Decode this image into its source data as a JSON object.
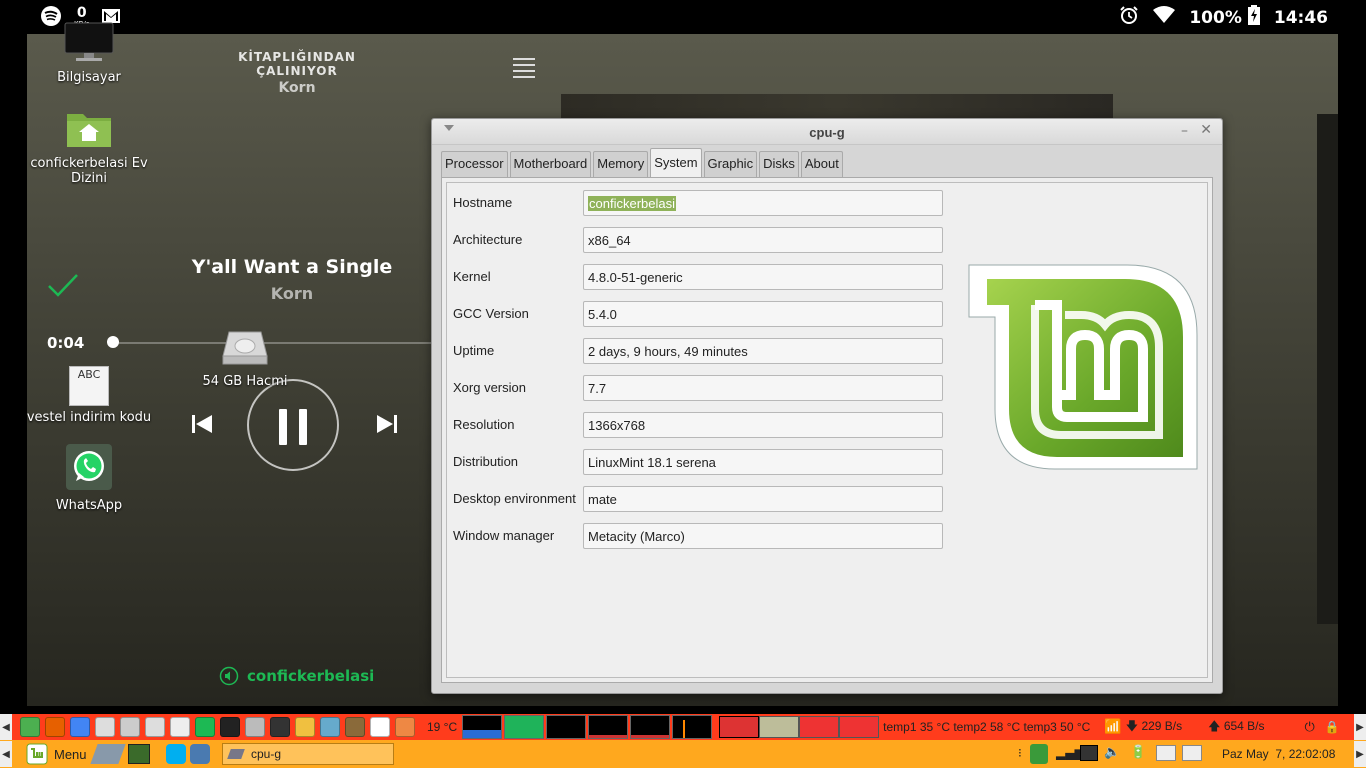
{
  "status_bar": {
    "net_speed_value": "0",
    "net_speed_unit": "KB/s",
    "battery": "100%",
    "time": "14:46",
    "icons": [
      "spotify-icon",
      "gmail-icon",
      "alarm-icon",
      "wifi-icon",
      "battery-icon"
    ]
  },
  "spotify": {
    "playing_from_label": "KİTAPLIĞINDAN ÇALINIYOR",
    "playing_from_name": "Korn",
    "track_title": "Y'all Want a Single",
    "track_artist": "Korn",
    "elapsed": "0:04",
    "progress": 0.02,
    "device": "confickerbelasi",
    "accent": "#1db954"
  },
  "desktop_icons": [
    {
      "label": "Bilgisayar"
    },
    {
      "label": "confickerbelasi Ev Dizini"
    },
    {
      "label": "54 GB Hacmi"
    },
    {
      "label": "vestel indirim kodu",
      "thumb": "ABC"
    },
    {
      "label": "WhatsApp"
    }
  ],
  "window": {
    "title": "cpu-g",
    "tabs": [
      "Processor",
      "Motherboard",
      "Memory",
      "System",
      "Graphic",
      "Disks",
      "About"
    ],
    "active_tab": "System",
    "fields": [
      {
        "label": "Hostname",
        "value": "confickerbelasi"
      },
      {
        "label": "Architecture",
        "value": "x86_64"
      },
      {
        "label": "Kernel",
        "value": "4.8.0-51-generic"
      },
      {
        "label": "GCC Version",
        "value": "5.4.0"
      },
      {
        "label": "Uptime",
        "value": "2 days, 9 hours, 49 minutes"
      },
      {
        "label": "Xorg version",
        "value": "7.7"
      },
      {
        "label": "Resolution",
        "value": "1366x768"
      },
      {
        "label": "Distribution",
        "value": "LinuxMint 18.1 serena"
      },
      {
        "label": "Desktop environment",
        "value": "mate"
      },
      {
        "label": "Window manager",
        "value": "Metacity (Marco)"
      }
    ],
    "logo_colors": {
      "green": "#6aa82a",
      "light": "#a6d34e"
    }
  },
  "top_panel": {
    "weather": "19 °C",
    "temps": "temp1 35 °C temp2 58 °C temp3 50 °C",
    "download": "229 B/s",
    "upload": "654 B/s",
    "color": "#ff3c1c"
  },
  "bottom_panel": {
    "menu_label": "Menu",
    "task_label": "cpu-g",
    "clock": "Paz May  7, 22:02:08",
    "color": "#ffa81e"
  }
}
